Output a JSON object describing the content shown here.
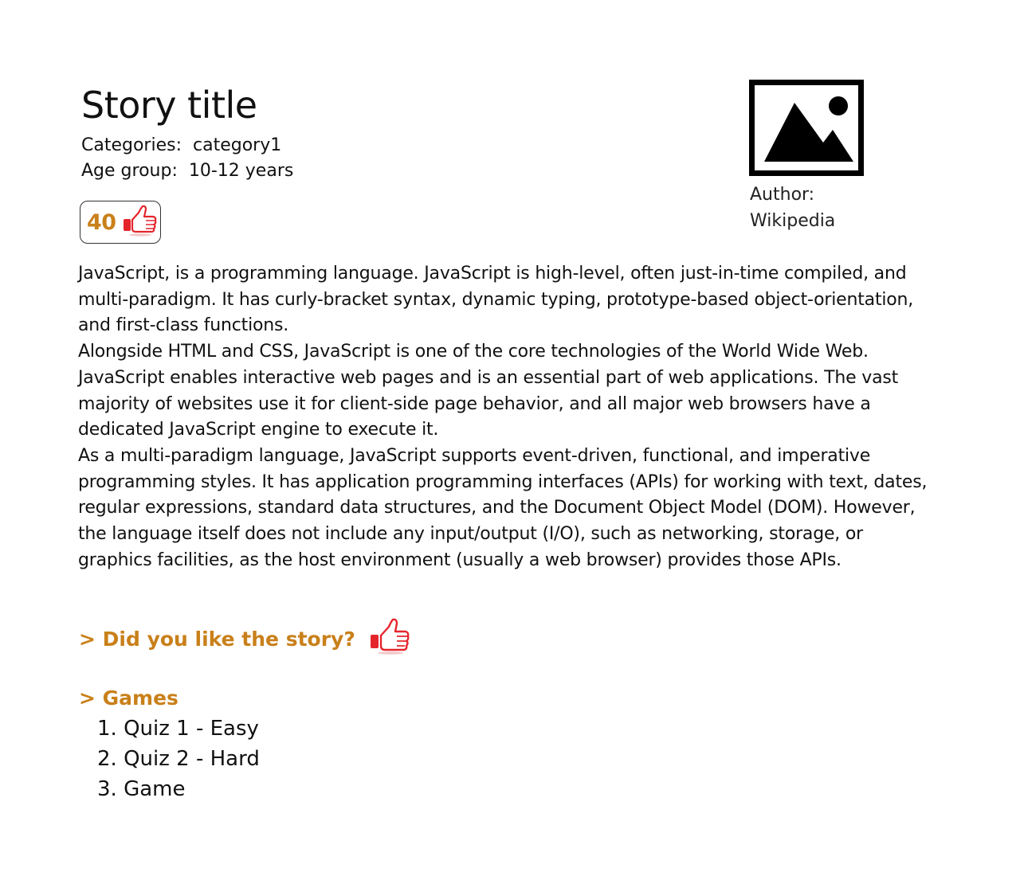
{
  "story": {
    "title": "Story title",
    "categories_label": "Categories:",
    "categories_value": "category1",
    "age_label": "Age group:",
    "age_value": "10-12 years",
    "likes_count": "40",
    "image_icon": "image-placeholder-icon",
    "author_label": "Author:",
    "author_name": "Wikipedia",
    "paragraphs": [
      "JavaScript, is a programming language. JavaScript is high-level, often just-in-time compiled, and multi-paradigm. It has curly-bracket syntax, dynamic typing, prototype-based object-orientation, and first-class functions.",
      "Alongside HTML and CSS, JavaScript is one of the core technologies of the World Wide Web. JavaScript enables interactive web pages and is an essential part of web applications. The vast majority of websites use it for client-side page behavior, and all major web browsers have a dedicated JavaScript engine to execute it.",
      "As a multi-paradigm language, JavaScript supports event-driven, functional, and imperative programming styles. It has application programming interfaces (APIs) for working with text, dates, regular expressions, standard data structures, and the Document Object Model (DOM). However, the language itself does not include any input/output (I/O), such as networking, storage, or graphics facilities, as the host environment (usually a web browser) provides those APIs."
    ]
  },
  "like_prompt": "> Did you like the story?",
  "like_icon": "thumbs-up-icon",
  "games": {
    "heading": "> Games",
    "items": [
      "1. Quiz 1 -  Easy",
      "2. Quiz 2 - Hard",
      "3. Game"
    ]
  },
  "colors": {
    "accent": "#c9801a",
    "thumb_red": "#e5252d"
  }
}
